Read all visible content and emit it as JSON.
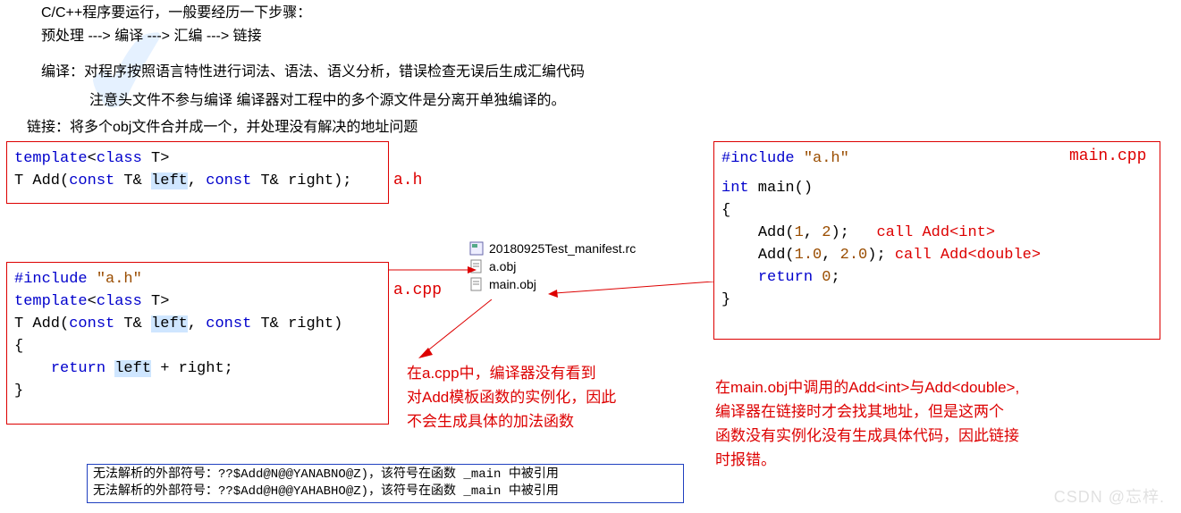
{
  "intro": {
    "line1": "C/C++程序要运行，一般要经历一下步骤：",
    "line2": "预处理 ---> 编译 ---> 汇编 ---> 链接",
    "line3": "编译：对程序按照语言特性进行词法、语法、语义分析，错误检查无误后生成汇编代码",
    "line4": "注意头文件不参与编译  编译器对工程中的多个源文件是分离开单独编译的。",
    "line5": "链接：将多个obj文件合并成一个，并处理没有解决的地址问题"
  },
  "box_ah": {
    "label": "a.h",
    "tmpl": "template",
    "cls": "class",
    "tp": " T",
    "ret": "T Add(",
    "const1": "const",
    "mid1": " T& ",
    "left": "left",
    "comma": ", ",
    "const2": "const",
    "mid2": " T& right);"
  },
  "box_acpp": {
    "label": "a.cpp",
    "inc": "#include ",
    "inc_str": "\"a.h\"",
    "tmpl": "template",
    "cls": "class",
    "tp": " T",
    "ret": "T Add(",
    "const1": "const",
    "mid1": " T& ",
    "left": "left",
    "comma": ", ",
    "const2": "const",
    "mid2": " T& right)",
    "brace_open": "{",
    "retkw": "return",
    "body": " ",
    "left2": "left",
    "plus": " + right;",
    "brace_close": "}"
  },
  "box_main": {
    "label": "main.cpp",
    "inc": "#include ",
    "inc_str": "\"a.h\"",
    "int": "int",
    "main": " main()",
    "brace_open": "{",
    "call1a": "Add(",
    "call1b": "1",
    "call1c": ", ",
    "call1d": "2",
    "call1e": ");",
    "ann1": "call Add<int>",
    "call2a": "Add(",
    "call2b": "1.0",
    "call2c": ", ",
    "call2d": "2.0",
    "call2e": ");",
    "ann2": "call Add<double>",
    "retkw": "return",
    "zero": " 0",
    "semi": ";",
    "brace_close": "}"
  },
  "files": {
    "f1": "20180925Test_manifest.rc",
    "f2": "a.obj",
    "f3": "main.obj"
  },
  "center_note": {
    "l1": "在a.cpp中，编译器没有看到",
    "l2": "对Add模板函数的实例化，因此",
    "l3": "不会生成具体的加法函数"
  },
  "right_note": {
    "l1": "在main.obj中调用的Add<int>与Add<double>,",
    "l2": "编译器在链接时才会找其地址，但是这两个",
    "l3": "函数没有实例化没有生成具体代码，因此链接",
    "l4": "时报错。"
  },
  "errbox": {
    "e1": "无法解析的外部符号：??$Add@N@@YANABNO@Z)，该符号在函数 _main 中被引用",
    "e2": "无法解析的外部符号：??$Add@H@@YAHABHO@Z)，该符号在函数 _main 中被引用"
  },
  "watermark": "CSDN @忘梓."
}
